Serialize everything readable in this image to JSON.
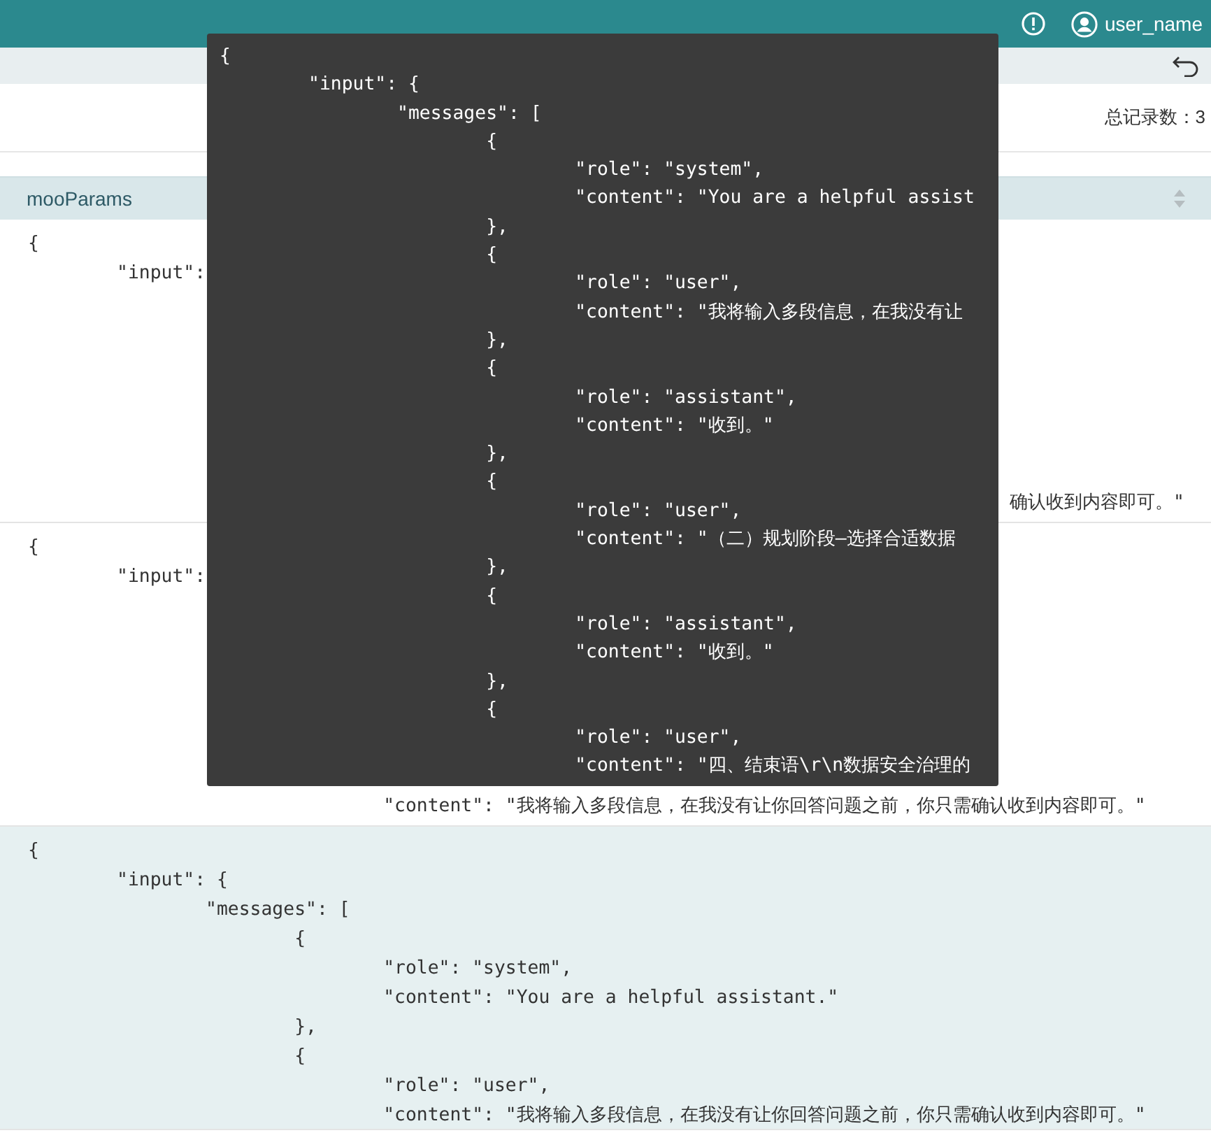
{
  "top_bar": {
    "user_name": "user_name"
  },
  "summary": {
    "total_records": "总记录数：3"
  },
  "table": {
    "columns": [
      {
        "label": "mooParams"
      }
    ],
    "rows": [
      {
        "selected": false,
        "lines": [
          {
            "kind": "code",
            "text": "{"
          },
          {
            "kind": "code",
            "text": "\t\"input\":"
          },
          {
            "kind": "tail",
            "text": "确认收到内容即可。\""
          }
        ]
      },
      {
        "selected": false,
        "lines": [
          {
            "kind": "code",
            "text": "{"
          },
          {
            "kind": "code",
            "text": "\t\"input\":"
          },
          {
            "kind": "end",
            "text": "\t\t\t\t\"content\": \"我将输入多段信息，在我没有让你回答问题之前，你只需确认收到内容即可。\""
          }
        ]
      },
      {
        "selected": true,
        "lines": [
          {
            "kind": "code",
            "text": "{"
          },
          {
            "kind": "code",
            "text": "\t\"input\": {"
          },
          {
            "kind": "code",
            "text": "\t\t\"messages\": ["
          },
          {
            "kind": "code",
            "text": "\t\t\t{"
          },
          {
            "kind": "code",
            "text": "\t\t\t\t\"role\": \"system\","
          },
          {
            "kind": "code",
            "text": "\t\t\t\t\"content\": \"You are a helpful assistant.\""
          },
          {
            "kind": "code",
            "text": "\t\t\t},"
          },
          {
            "kind": "code",
            "text": "\t\t\t{"
          },
          {
            "kind": "code",
            "text": "\t\t\t\t\"role\": \"user\","
          },
          {
            "kind": "code",
            "text": "\t\t\t\t\"content\": \"我将输入多段信息，在我没有让你回答问题之前，你只需确认收到内容即可。\""
          }
        ]
      }
    ]
  },
  "tooltip": {
    "lines": [
      "{",
      "\t\"input\": {",
      "\t\t\"messages\": [",
      "\t\t\t{",
      "\t\t\t\t\"role\": \"system\",",
      "\t\t\t\t\"content\": \"You are a helpful assist",
      "\t\t\t},",
      "\t\t\t{",
      "\t\t\t\t\"role\": \"user\",",
      "\t\t\t\t\"content\": \"我将输入多段信息，在我没有让",
      "\t\t\t},",
      "\t\t\t{",
      "\t\t\t\t\"role\": \"assistant\",",
      "\t\t\t\t\"content\": \"收到。\"",
      "\t\t\t},",
      "\t\t\t{",
      "\t\t\t\t\"role\": \"user\",",
      "\t\t\t\t\"content\": \"（二）规划阶段—选择合适数据",
      "\t\t\t},",
      "\t\t\t{",
      "\t\t\t\t\"role\": \"assistant\",",
      "\t\t\t\t\"content\": \"收到。\"",
      "\t\t\t},",
      "\t\t\t{",
      "\t\t\t\t\"role\": \"user\",",
      "\t\t\t\t\"content\": \"四、结束语\\r\\n数据安全治理的"
    ]
  }
}
